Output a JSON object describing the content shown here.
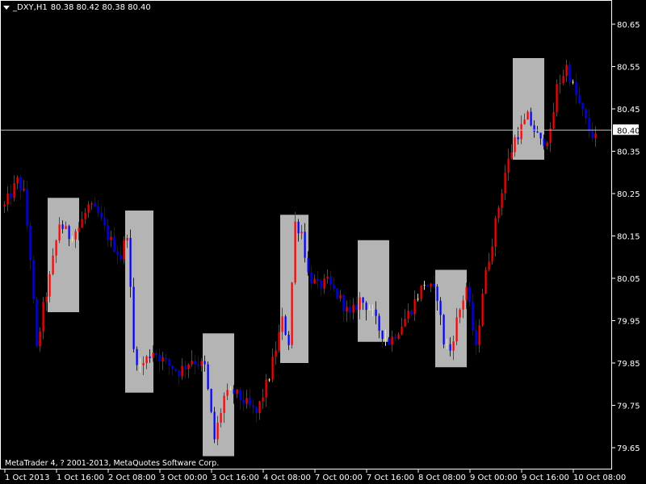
{
  "header": {
    "symbol": "_DXY,H1",
    "quote": "80.38 80.42 80.38 80.40"
  },
  "footer": {
    "copyright": "MetaTrader 4, ? 2001-2013, MetaQuotes Software Corp."
  },
  "colors": {
    "background": "#000000",
    "up_candle": "#ff0000",
    "down_candle": "#0000ff",
    "doji": "#ffff00",
    "highlight_box": "#b4b4b4",
    "axis": "#ffffff",
    "price_line": "#c0c0c0"
  },
  "chart_data": {
    "type": "candlestick",
    "y_ticks": [
      "80.65",
      "80.55",
      "80.45",
      "80.35",
      "80.25",
      "80.15",
      "80.05",
      "79.95",
      "79.85",
      "79.75",
      "79.65"
    ],
    "x_ticks": [
      "1 Oct 2013",
      "1 Oct 16:00",
      "2 Oct 08:00",
      "3 Oct 00:00",
      "3 Oct 16:00",
      "4 Oct 08:00",
      "7 Oct 00:00",
      "7 Oct 16:00",
      "8 Oct 08:00",
      "9 Oct 00:00",
      "9 Oct 16:00",
      "10 Oct 08:00"
    ],
    "current_price": "80.40",
    "ylim": [
      79.62,
      80.68
    ],
    "highlight_boxes": [
      {
        "bar_start": 14,
        "bar_end": 23,
        "high": 80.24,
        "low": 79.97
      },
      {
        "bar_start": 38,
        "bar_end": 46,
        "high": 80.21,
        "low": 79.78
      },
      {
        "bar_start": 62,
        "bar_end": 71,
        "high": 79.92,
        "low": 79.63
      },
      {
        "bar_start": 86,
        "bar_end": 94,
        "high": 80.2,
        "low": 79.85
      },
      {
        "bar_start": 110,
        "bar_end": 119,
        "high": 80.14,
        "low": 79.9
      },
      {
        "bar_start": 134,
        "bar_end": 143,
        "high": 80.07,
        "low": 79.84
      },
      {
        "bar_start": 158,
        "bar_end": 167,
        "high": 80.57,
        "low": 80.33
      }
    ],
    "waypoints": [
      [
        0,
        80.22
      ],
      [
        4,
        80.28
      ],
      [
        6,
        80.25
      ],
      [
        8,
        80.1
      ],
      [
        10,
        79.88
      ],
      [
        12,
        79.98
      ],
      [
        14,
        80.05
      ],
      [
        17,
        80.18
      ],
      [
        20,
        80.15
      ],
      [
        23,
        80.17
      ],
      [
        26,
        80.22
      ],
      [
        29,
        80.2
      ],
      [
        32,
        80.15
      ],
      [
        36,
        80.1
      ],
      [
        38,
        80.16
      ],
      [
        40,
        79.88
      ],
      [
        42,
        79.84
      ],
      [
        46,
        79.88
      ],
      [
        50,
        79.85
      ],
      [
        54,
        79.83
      ],
      [
        58,
        79.86
      ],
      [
        62,
        79.84
      ],
      [
        65,
        79.67
      ],
      [
        68,
        79.77
      ],
      [
        71,
        79.78
      ],
      [
        74,
        79.76
      ],
      [
        78,
        79.73
      ],
      [
        82,
        79.82
      ],
      [
        86,
        79.95
      ],
      [
        88,
        79.9
      ],
      [
        90,
        80.18
      ],
      [
        92,
        80.16
      ],
      [
        94,
        80.06
      ],
      [
        97,
        80.03
      ],
      [
        100,
        80.04
      ],
      [
        104,
        80.0
      ],
      [
        107,
        79.96
      ],
      [
        110,
        80.0
      ],
      [
        113,
        79.98
      ],
      [
        116,
        79.93
      ],
      [
        119,
        79.9
      ],
      [
        122,
        79.93
      ],
      [
        126,
        79.98
      ],
      [
        130,
        80.04
      ],
      [
        134,
        80.01
      ],
      [
        136,
        79.9
      ],
      [
        138,
        79.88
      ],
      [
        140,
        79.95
      ],
      [
        143,
        80.03
      ],
      [
        146,
        79.88
      ],
      [
        148,
        80.02
      ],
      [
        150,
        80.1
      ],
      [
        152,
        80.18
      ],
      [
        155,
        80.3
      ],
      [
        158,
        80.38
      ],
      [
        162,
        80.43
      ],
      [
        166,
        80.37
      ],
      [
        169,
        80.39
      ],
      [
        171,
        80.5
      ],
      [
        174,
        80.55
      ],
      [
        177,
        80.48
      ],
      [
        181,
        80.4
      ],
      [
        183,
        80.38
      ]
    ]
  }
}
